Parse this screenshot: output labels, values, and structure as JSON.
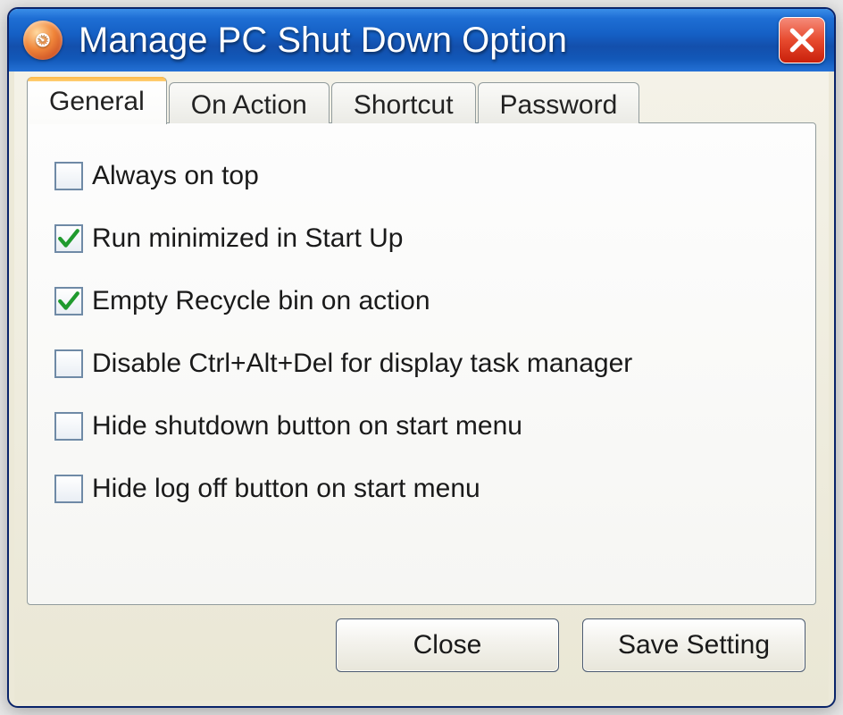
{
  "window": {
    "title": "Manage PC Shut Down Option",
    "icon_glyph": "⏲"
  },
  "tabs": [
    {
      "label": "General",
      "active": true
    },
    {
      "label": "On Action",
      "active": false
    },
    {
      "label": "Shortcut",
      "active": false
    },
    {
      "label": "Password",
      "active": false
    }
  ],
  "options": [
    {
      "label": "Always on top",
      "checked": false
    },
    {
      "label": "Run minimized in Start Up",
      "checked": true
    },
    {
      "label": "Empty Recycle bin on action",
      "checked": true
    },
    {
      "label": "Disable Ctrl+Alt+Del for display task manager",
      "checked": false
    },
    {
      "label": "Hide shutdown button on start menu",
      "checked": false
    },
    {
      "label": "Hide log off button on start menu",
      "checked": false
    }
  ],
  "buttons": {
    "close": "Close",
    "save": "Save Setting"
  }
}
